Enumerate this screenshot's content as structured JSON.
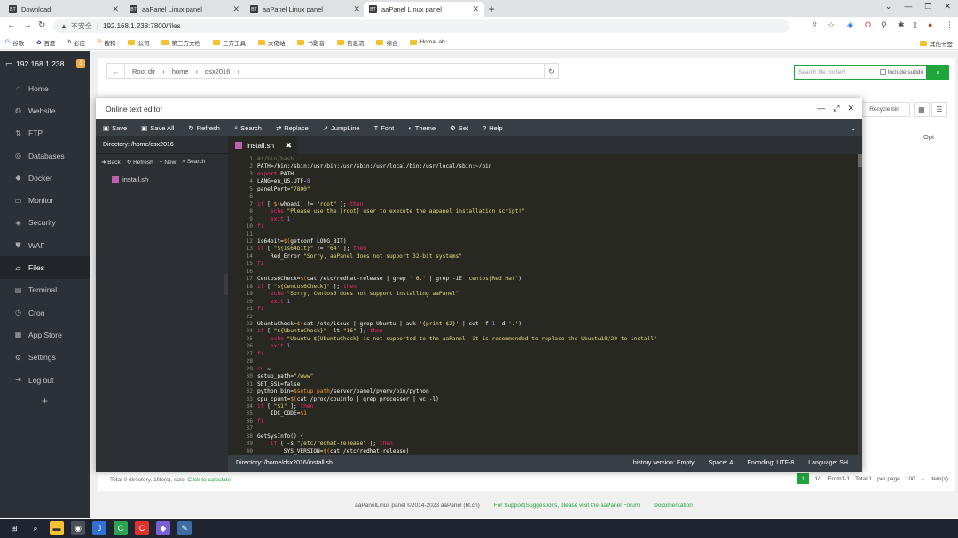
{
  "browser": {
    "tabs": [
      {
        "label": "Download",
        "fav": "BT"
      },
      {
        "label": "aaPanel Linux panel",
        "fav": "BT"
      },
      {
        "label": "aaPanel Linux panel",
        "fav": "BT"
      },
      {
        "label": "aaPanel Linux panel",
        "fav": "BT"
      }
    ],
    "address": {
      "insecure": "不安全",
      "url": "192.168.1.238:7800/files"
    },
    "bookmarks": [
      "谷歌",
      "百度",
      "必应",
      "搜狗",
      "公司",
      "第三方文档",
      "三方工具",
      "大佬站",
      "书影音",
      "信息流",
      "综合",
      "HomaLab"
    ],
    "bookmarks_right": "其他书签"
  },
  "sidebar": {
    "server": "192.168.1.238",
    "badge": "5",
    "items": [
      {
        "label": "Home",
        "icon": "home-icon"
      },
      {
        "label": "Website",
        "icon": "globe-icon"
      },
      {
        "label": "FTP",
        "icon": "ftp-icon"
      },
      {
        "label": "Databases",
        "icon": "database-icon"
      },
      {
        "label": "Docker",
        "icon": "docker-icon"
      },
      {
        "label": "Monitor",
        "icon": "monitor-icon"
      },
      {
        "label": "Security",
        "icon": "shield-icon"
      },
      {
        "label": "WAF",
        "icon": "waf-icon"
      },
      {
        "label": "Files",
        "icon": "folder-icon"
      },
      {
        "label": "Terminal",
        "icon": "terminal-icon"
      },
      {
        "label": "Cron",
        "icon": "clock-icon"
      },
      {
        "label": "App Store",
        "icon": "grid-icon"
      },
      {
        "label": "Settings",
        "icon": "gear-icon"
      },
      {
        "label": "Log out",
        "icon": "logout-icon"
      }
    ],
    "active": "Files"
  },
  "files": {
    "crumbs": [
      "Root dir",
      "home",
      "dsx2016"
    ],
    "search_placeholder": "Search file content",
    "include_subdir": "Include subdir",
    "recycle": "Recycle bin",
    "opt_col": "Opt",
    "summary": "Total 0 directory, 1file(s), size:",
    "calc_link": "Click to calculate",
    "pager": {
      "page": "1",
      "of": "1/1",
      "range": "From1-1",
      "total": "Total 1",
      "per_page_label": "per page",
      "per_page": "100",
      "unit": "item(s)"
    }
  },
  "footer": {
    "copyright": "aaPanelLinux panel ©2014-2023 aaPanel (bt.cn)",
    "support": "For Support|Suggestions, please visit the aaPanel Forum",
    "docs": "Documentation"
  },
  "editor": {
    "title": "Online text editor",
    "toolbar": [
      "Save",
      "Save All",
      "Refresh",
      "Search",
      "Replace",
      "JumpLine",
      "Font",
      "Theme",
      "Set",
      "Help"
    ],
    "directory": "Directory: /home/dsx2016",
    "ftools": [
      "Back",
      "Refresh",
      "New",
      "Search"
    ],
    "file": "install.sh",
    "tab": "install.sh",
    "status": {
      "path": "Directory: /home/dsx2016/install.sh",
      "history": "history version: Empty",
      "space": "Space: 4",
      "encoding": "Encoding: UTF-8",
      "language": "Language: SH"
    },
    "code": [
      "#!/bin/bash",
      "PATH=/bin:/sbin:/usr/bin:/usr/sbin:/usr/local/bin:/usr/local/sbin:~/bin",
      "export PATH",
      "LANG=en_US.UTF-8",
      "panelPort=\"7800\"",
      "",
      "if [ $(whoami) != \"root\" ]; then",
      "    echo \"Please use the [root] user to execute the aapanel installation script!\"",
      "    exit 1",
      "fi",
      "",
      "is64bit=$(getconf LONG_BIT)",
      "if [ \"${is64bit}\" != '64' ]; then",
      "    Red_Error \"Sorry, aaPanel does not support 32-bit systems\"",
      "fi",
      "",
      "Centos6Check=$(cat /etc/redhat-release | grep ' 6.' | grep -iE 'centos|Red Hat')",
      "if [ \"${Centos6Check}\" ]; then",
      "    echo \"Sorry, Centos6 does not support installing aaPanel\"",
      "    exit 1",
      "fi",
      "",
      "UbuntuCheck=$(cat /etc/issue | grep Ubuntu | awk '{print $2}' | cut -f 1 -d '.')",
      "if [ \"${UbuntuCheck}\" -lt \"16\" ]; then",
      "    echo \"Ubuntu ${UbuntuCheck} is not supported to the aaPanel, it is recommended to replace the Ubuntu18/20 to install\"",
      "    exit 1",
      "fi",
      "",
      "cd ~",
      "setup_path=\"/www\"",
      "SET_SSL=false",
      "python_bin=$setup_path/server/panel/pyenv/bin/python",
      "cpu_cpunt=$(cat /proc/cpuinfo | grep processor | wc -l)",
      "if [ \"$1\" ]; then",
      "    IDC_CODE=$1",
      "fi",
      "",
      "GetSysInfo() {",
      "    if [ -s \"/etc/redhat-release\" ]; then",
      "        SYS_VERSION=$(cat /etc/redhat-release)"
    ]
  },
  "colors": {
    "accent": "#20a53a",
    "sidebar": "#2c3138",
    "editor_bg": "#272822"
  }
}
